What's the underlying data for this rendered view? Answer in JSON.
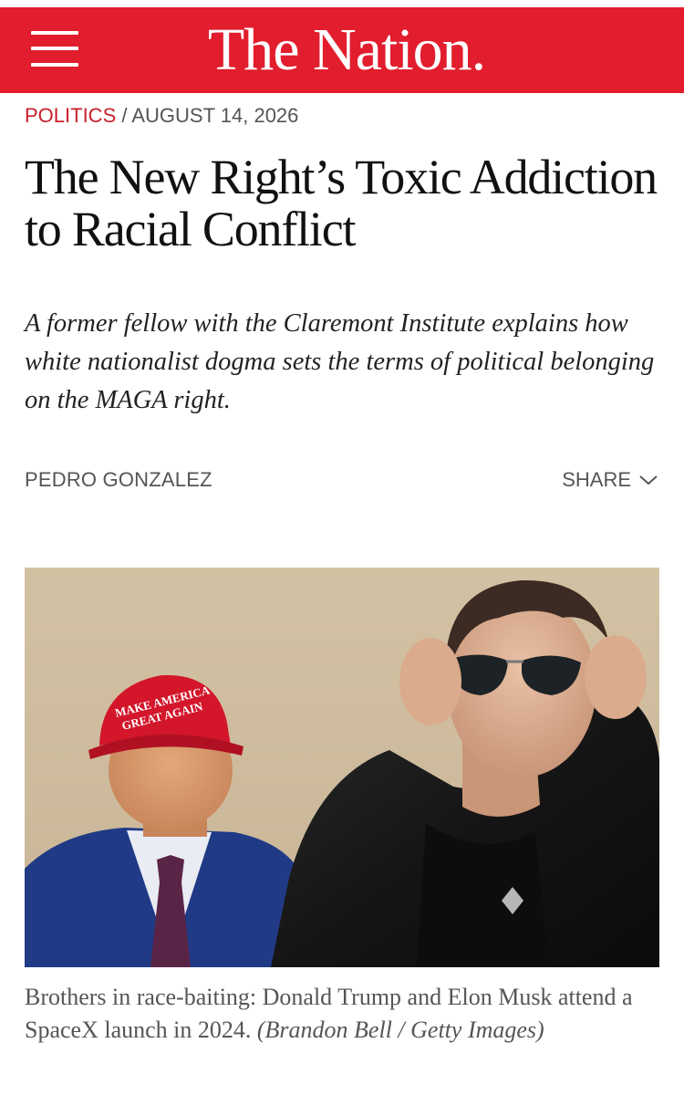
{
  "header": {
    "brand_color": "#e21d2d",
    "menu_icon": "hamburger-menu-icon",
    "logo": "The Nation."
  },
  "article": {
    "section": "POLITICS",
    "separator": " / ",
    "date": "AUGUST 14, 2026",
    "headline": "The New Right’s Toxic Addiction to Racial Conflict",
    "dek": "A former fellow with the Claremont Institute explains how white nationalist dogma sets the terms of political belonging on the MAGA right.",
    "author": "PEDRO GONZALEZ",
    "share_label": "SHARE",
    "share_icon": "chevron-down-icon"
  },
  "photo": {
    "hat_text_line1": "MAKE AMERICA",
    "hat_text_line2": "GREAT AGAIN",
    "caption": "Brothers in race-baiting: Donald Trump and Elon Musk attend a SpaceX launch in 2024.",
    "credit": "(Brandon Bell / Getty Images)"
  }
}
